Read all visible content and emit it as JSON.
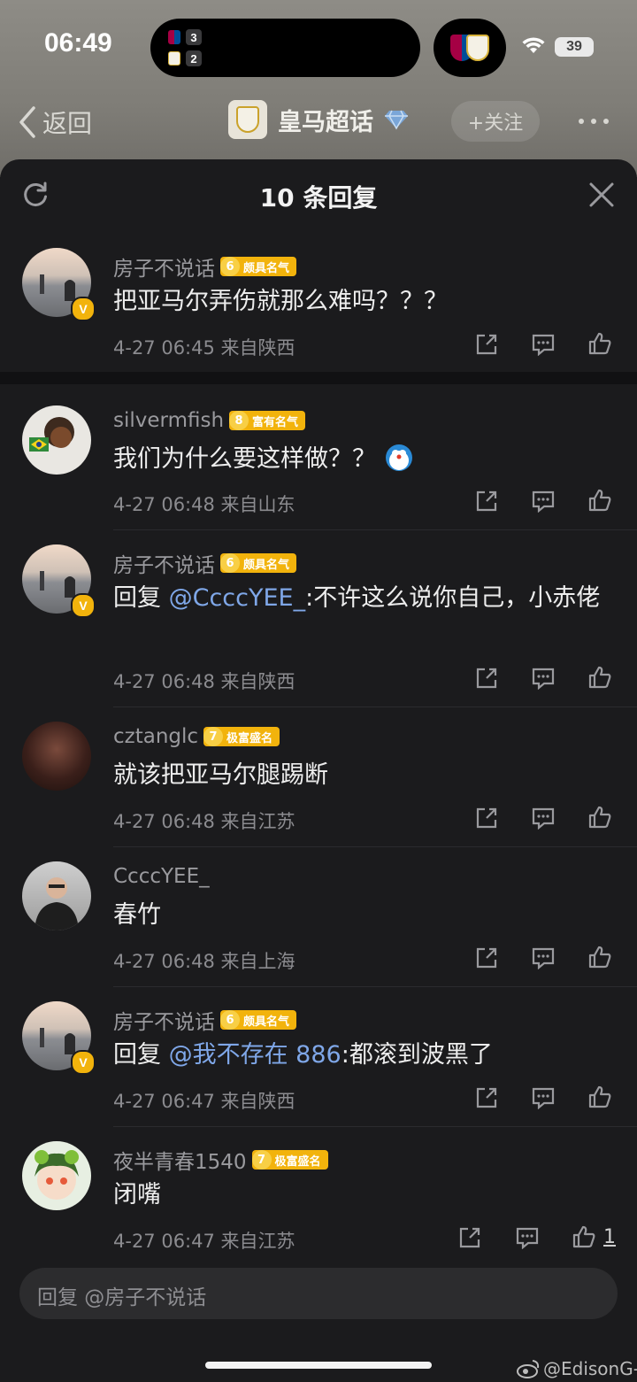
{
  "status_bar": {
    "time": "06:49",
    "scores": [
      {
        "team": "Barcelona",
        "score": "3"
      },
      {
        "team": "Real Madrid",
        "score": "2"
      }
    ],
    "battery": "39"
  },
  "nav": {
    "back_label": "返回",
    "title": "皇马超话",
    "follow_label": "+关注"
  },
  "sheet": {
    "title": "10 条回复"
  },
  "comments": [
    {
      "username": "房子不说话",
      "level": "6",
      "badge": "颇具名气",
      "text": "把亚马尔弄伤就那么难吗？？？",
      "meta": "4-27 06:45 来自陕西"
    },
    {
      "username": "silvermfish",
      "level": "8",
      "badge": "富有名气",
      "text": "我们为什么要这样做？？",
      "meta": "4-27 06:48 来自山东"
    },
    {
      "username": "房子不说话",
      "level": "6",
      "badge": "颇具名气",
      "reply_prefix": "回复 ",
      "mention": "@CcccYEE_",
      "text": ":不许这么说你自己，小赤佬",
      "meta": "4-27 06:48 来自陕西"
    },
    {
      "username": "cztanglc",
      "level": "7",
      "badge": "极富盛名",
      "text": "就该把亚马尔腿踢断",
      "meta": "4-27 06:48 来自江苏"
    },
    {
      "username": "CcccYEE_",
      "text": "春竹",
      "meta": "4-27 06:48 来自上海"
    },
    {
      "username": "房子不说话",
      "level": "6",
      "badge": "颇具名气",
      "reply_prefix": "回复 ",
      "mention": "@我不存在 886",
      "text": ":都滚到波黑了",
      "meta": "4-27 06:47 来自陕西"
    },
    {
      "username": "夜半青春1540",
      "level": "7",
      "badge": "极富盛名",
      "text": "闭嘴",
      "meta": "4-27 06:47 来自江苏",
      "likes": "1"
    }
  ],
  "reply_input": {
    "placeholder": "回复 @房子不说话"
  },
  "watermark": "@EdisonG-",
  "colors": {
    "accent_gold": "#f2b30c",
    "mention_blue": "#7fa7e8",
    "sheet_bg": "#1b1b1d"
  }
}
